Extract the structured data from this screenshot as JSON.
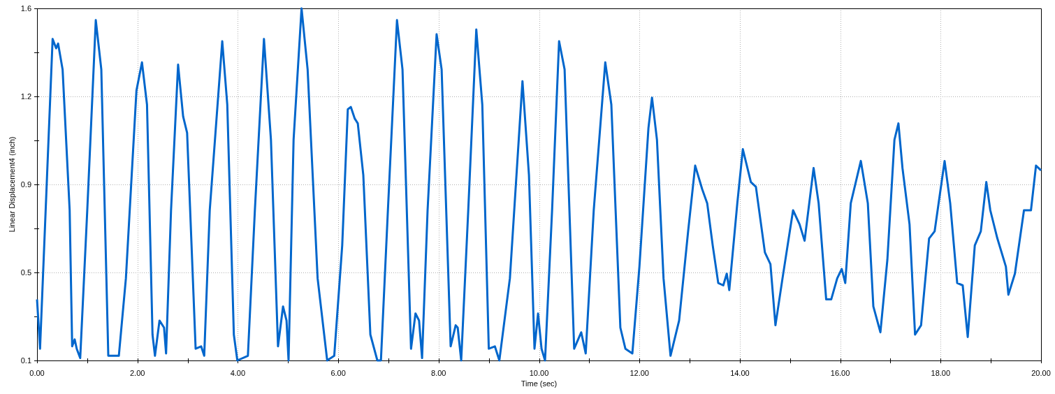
{
  "chart": {
    "chart_data": {
      "type": "line",
      "grid": true,
      "xlabel": "Time (sec)",
      "ylabel": "Linear Displacement4 (inch)",
      "xlim": [
        0,
        20
      ],
      "ylim": [
        0.1,
        1.6
      ],
      "xticks": [
        {
          "value": 0,
          "label": "0.00"
        },
        {
          "value": 2,
          "label": "2.00"
        },
        {
          "value": 4,
          "label": "4.00"
        },
        {
          "value": 6,
          "label": "6.00"
        },
        {
          "value": 8,
          "label": "8.00"
        },
        {
          "value": 10,
          "label": "10.00"
        },
        {
          "value": 12,
          "label": "12.00"
        },
        {
          "value": 14,
          "label": "14.00"
        },
        {
          "value": 16,
          "label": "16.00"
        },
        {
          "value": 18,
          "label": "18.00"
        },
        {
          "value": 20,
          "label": "20.00"
        }
      ],
      "yticks": [
        {
          "value": 0.1,
          "label": "0.1"
        },
        {
          "value": 0.475,
          "label": "0.5"
        },
        {
          "value": 0.85,
          "label": "0.9"
        },
        {
          "value": 1.225,
          "label": "1.2"
        },
        {
          "value": 1.6,
          "label": "1.6"
        }
      ],
      "x": [
        0,
        0.06,
        0.31,
        0.38,
        0.42,
        0.51,
        0.65,
        0.7,
        0.75,
        0.79,
        0.86,
        1.0,
        1.17,
        1.28,
        1.42,
        1.63,
        1.77,
        1.98,
        2.09,
        2.19,
        2.3,
        2.35,
        2.44,
        2.53,
        2.57,
        2.67,
        2.81,
        2.91,
        2.99,
        3.16,
        3.27,
        3.33,
        3.44,
        3.69,
        3.79,
        3.92,
        3.99,
        4.2,
        4.34,
        4.52,
        4.66,
        4.8,
        4.9,
        4.97,
        5.01,
        5.11,
        5.27,
        5.39,
        5.59,
        5.78,
        5.92,
        6.08,
        6.19,
        6.25,
        6.33,
        6.39,
        6.5,
        6.64,
        6.78,
        6.85,
        6.99,
        7.17,
        7.28,
        7.45,
        7.54,
        7.61,
        7.67,
        7.78,
        7.96,
        8.06,
        8.24,
        8.34,
        8.38,
        8.45,
        8.59,
        8.75,
        8.87,
        9.0,
        9.12,
        9.21,
        9.42,
        9.67,
        9.8,
        9.91,
        9.98,
        10.05,
        10.12,
        10.26,
        10.4,
        10.51,
        10.7,
        10.84,
        10.93,
        11.09,
        11.32,
        11.44,
        11.62,
        11.72,
        11.86,
        12.0,
        12.18,
        12.25,
        12.35,
        12.48,
        12.62,
        12.79,
        12.97,
        13.11,
        13.25,
        13.35,
        13.46,
        13.57,
        13.67,
        13.74,
        13.79,
        13.95,
        14.06,
        14.22,
        14.32,
        14.5,
        14.61,
        14.71,
        14.85,
        15.06,
        15.19,
        15.29,
        15.47,
        15.57,
        15.72,
        15.82,
        15.94,
        16.03,
        16.1,
        16.21,
        16.41,
        16.55,
        16.66,
        16.8,
        16.94,
        17.08,
        17.16,
        17.24,
        17.38,
        17.49,
        17.61,
        17.77,
        17.88,
        18.08,
        18.19,
        18.33,
        18.44,
        18.54,
        18.68,
        18.8,
        18.91,
        18.99,
        19.13,
        19.3,
        19.35,
        19.48,
        19.66,
        19.8,
        19.9,
        20.0
      ],
      "series": [
        {
          "color": "#0066cc",
          "values": [
            0.36,
            0.15,
            1.47,
            1.43,
            1.45,
            1.34,
            0.74,
            0.16,
            0.19,
            0.15,
            0.11,
            0.74,
            1.55,
            1.34,
            0.12,
            0.12,
            0.45,
            1.25,
            1.37,
            1.19,
            0.21,
            0.12,
            0.27,
            0.24,
            0.13,
            0.74,
            1.36,
            1.14,
            1.07,
            0.15,
            0.16,
            0.12,
            0.74,
            1.46,
            1.19,
            0.21,
            0.1,
            0.12,
            0.74,
            1.47,
            1.04,
            0.16,
            0.33,
            0.27,
            0.1,
            1.04,
            1.6,
            1.34,
            0.45,
            0.1,
            0.12,
            0.59,
            1.17,
            1.18,
            1.13,
            1.11,
            0.89,
            0.21,
            0.1,
            0.1,
            0.74,
            1.55,
            1.34,
            0.15,
            0.3,
            0.27,
            0.11,
            0.74,
            1.49,
            1.34,
            0.16,
            0.25,
            0.24,
            0.1,
            0.74,
            1.51,
            1.19,
            0.15,
            0.16,
            0.1,
            0.45,
            1.29,
            0.89,
            0.15,
            0.3,
            0.15,
            0.1,
            0.74,
            1.46,
            1.34,
            0.15,
            0.22,
            0.13,
            0.74,
            1.37,
            1.19,
            0.24,
            0.15,
            0.13,
            0.5,
            1.09,
            1.22,
            1.04,
            0.45,
            0.12,
            0.27,
            0.65,
            0.93,
            0.83,
            0.77,
            0.59,
            0.43,
            0.42,
            0.47,
            0.4,
            0.77,
            1.0,
            0.86,
            0.84,
            0.56,
            0.51,
            0.25,
            0.45,
            0.74,
            0.68,
            0.61,
            0.92,
            0.77,
            0.36,
            0.36,
            0.45,
            0.49,
            0.43,
            0.77,
            0.95,
            0.77,
            0.33,
            0.22,
            0.53,
            1.04,
            1.11,
            0.92,
            0.68,
            0.21,
            0.25,
            0.62,
            0.65,
            0.95,
            0.77,
            0.43,
            0.42,
            0.2,
            0.59,
            0.65,
            0.86,
            0.74,
            0.62,
            0.5,
            0.38,
            0.47,
            0.74,
            0.74,
            0.93,
            0.91
          ]
        }
      ]
    }
  }
}
